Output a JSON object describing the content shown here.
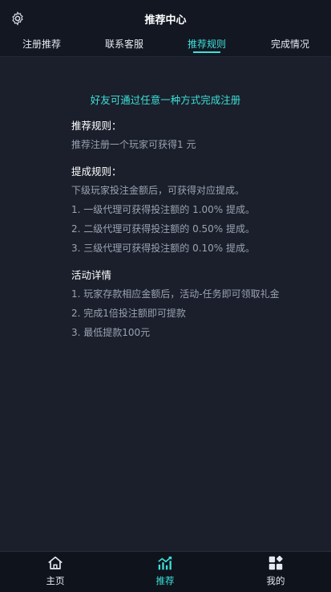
{
  "header": {
    "title": "推荐中心",
    "settings_icon": "gear-icon"
  },
  "tabs": [
    {
      "label": "注册推荐",
      "active": false
    },
    {
      "label": "联系客服",
      "active": false
    },
    {
      "label": "推荐规则",
      "active": true
    },
    {
      "label": "完成情况",
      "active": false
    }
  ],
  "main": {
    "headline": "好友可通过任意一种方式完成注册",
    "sections": [
      {
        "title": "推荐规则：",
        "lines": [
          "推荐注册一个玩家可获得1 元"
        ]
      },
      {
        "title": "提成规则：",
        "lines": [
          "下级玩家投注金额后，可获得对应提成。",
          "1. 一级代理可获得投注额的 1.00% 提成。",
          "2. 二级代理可获得投注额的 0.50% 提成。",
          "3. 三级代理可获得投注额的 0.10% 提成。"
        ]
      },
      {
        "title": "活动详情",
        "lines": [
          "1. 玩家存款相应金额后，活动-任务即可领取礼金",
          "2. 完成1倍投注额即可提款",
          "3. 最低提款100元"
        ]
      }
    ]
  },
  "bottom_nav": [
    {
      "label": "主页",
      "icon": "home-icon",
      "active": false
    },
    {
      "label": "推荐",
      "icon": "chart-trend-icon",
      "active": true
    },
    {
      "label": "我的",
      "icon": "grid-apps-icon",
      "active": false
    }
  ],
  "colors": {
    "accent": "#3ee0d8",
    "background": "#1a1f2b",
    "bar": "#121722"
  }
}
